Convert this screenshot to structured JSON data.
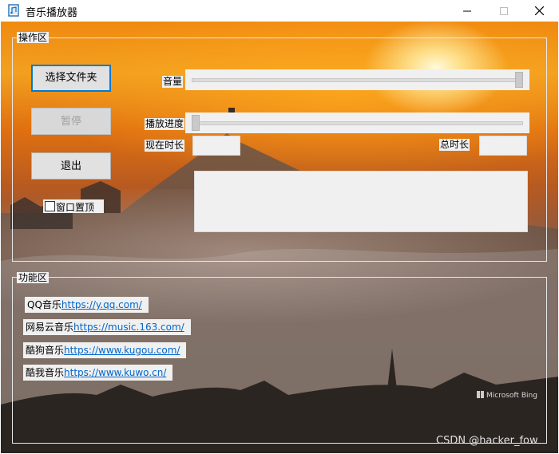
{
  "window": {
    "title": "音乐播放器"
  },
  "ops_group": {
    "title": "操作区",
    "select_folder": "选择文件夹",
    "pause": "暂停",
    "exit": "退出",
    "pin_on_top": "窗口置顶",
    "volume_label": "音量",
    "progress_label": "播放进度",
    "current_time_label": "现在时长",
    "total_time_label": "总时长",
    "volume_value": 1.0,
    "progress_value": 0.0
  },
  "func_group": {
    "title": "功能区",
    "links": [
      {
        "name": "QQ音乐",
        "url": "https://y.qq.com/"
      },
      {
        "name": "网易云音乐",
        "url": "https://music.163.com/"
      },
      {
        "name": "酷狗音乐",
        "url": "https://www.kugou.com/"
      },
      {
        "name": "酷我音乐",
        "url": "https://www.kuwo.cn/"
      }
    ]
  },
  "watermarks": {
    "bing": "Microsoft Bing",
    "csdn": "CSDN @hacker_fow"
  }
}
